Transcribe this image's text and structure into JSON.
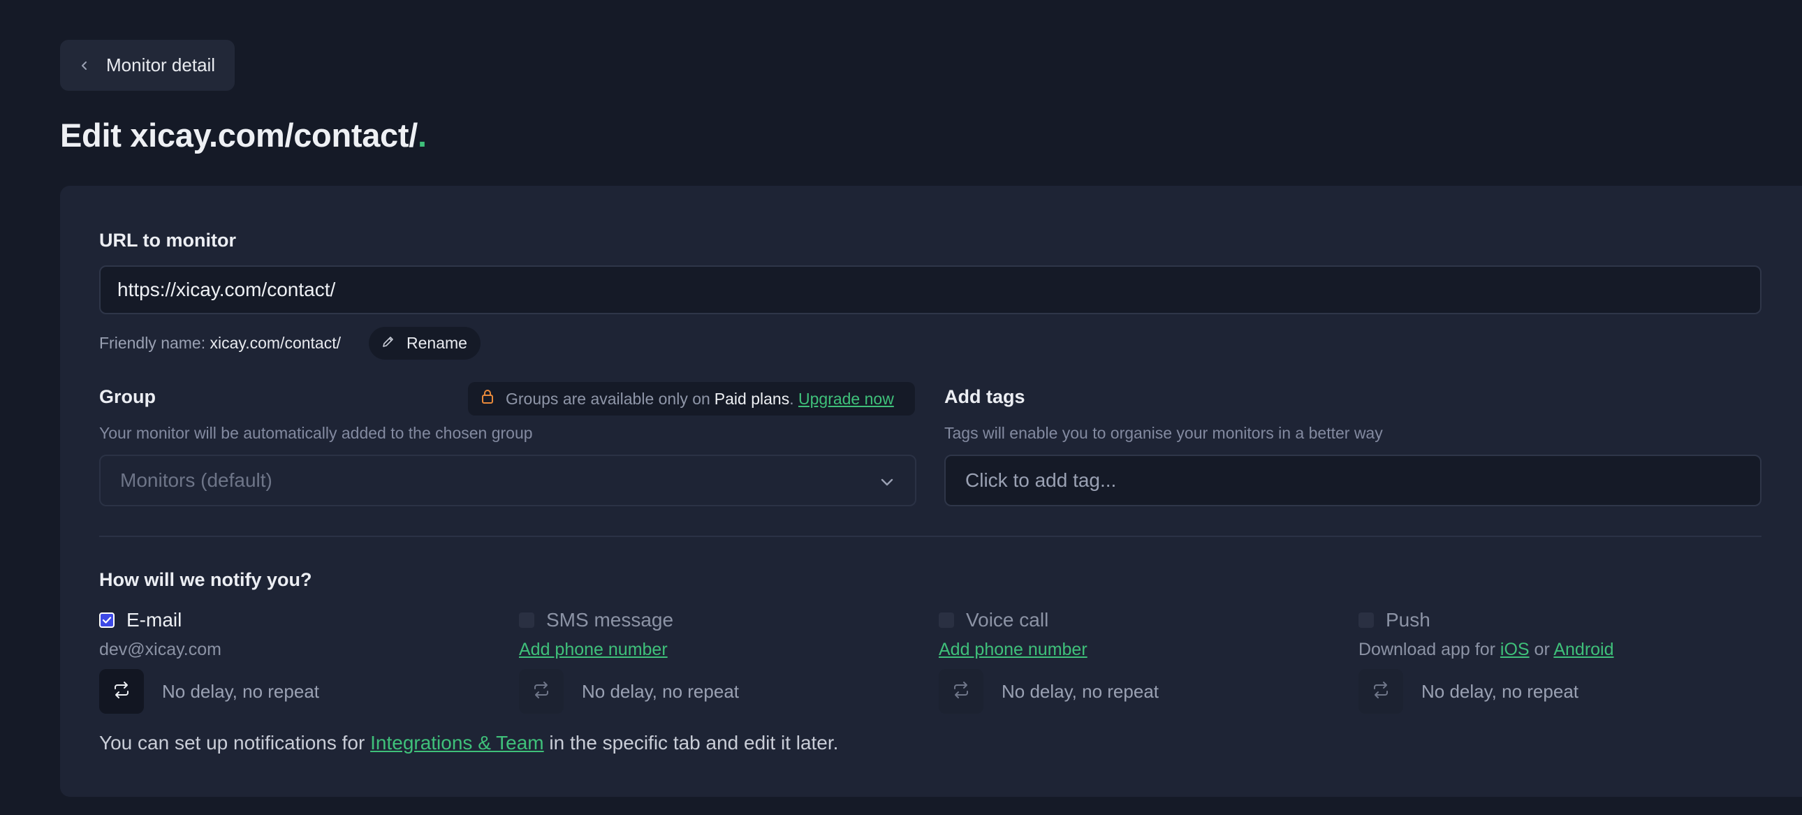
{
  "nav": {
    "back_label": "Monitor detail"
  },
  "page": {
    "title_prefix": "Edit ",
    "title_name": "xicay.com/contact/",
    "title_dot": "."
  },
  "url_section": {
    "label": "URL to monitor",
    "value": "https://xicay.com/contact/",
    "friendly_prefix": "Friendly name: ",
    "friendly_value": "xicay.com/contact/",
    "rename_label": "Rename"
  },
  "group": {
    "label": "Group",
    "hint": "Your monitor will be automatically added to the chosen group",
    "selected": "Monitors (default)",
    "notice_text": "Groups are available only on",
    "notice_plan": "Paid plans",
    "notice_punct": ".",
    "notice_link": "Upgrade now"
  },
  "tags": {
    "label": "Add tags",
    "hint": "Tags will enable you to organise your monitors in a better way",
    "placeholder": "Click to add tag..."
  },
  "notify": {
    "heading": "How will we notify you?",
    "channels": [
      {
        "label": "E-mail",
        "checked": true,
        "sub_text": "dev@xicay.com",
        "repeat_text": "No delay, no repeat"
      },
      {
        "label": "SMS message",
        "checked": false,
        "sub_link": "Add phone number",
        "repeat_text": "No delay, no repeat"
      },
      {
        "label": "Voice call",
        "checked": false,
        "sub_link": "Add phone number",
        "repeat_text": "No delay, no repeat"
      },
      {
        "label": "Push",
        "checked": false,
        "sub_prefix": "Download app for ",
        "sub_link_1": "iOS",
        "sub_mid": " or ",
        "sub_link_2": "Android",
        "repeat_text": "No delay, no repeat"
      }
    ],
    "footer_prefix": "You can set up notifications for ",
    "footer_link": "Integrations & Team",
    "footer_suffix": " in the specific tab and edit it later."
  },
  "colors": {
    "background": "#151a27",
    "card": "#1e2435",
    "accent_green": "#3fc07a",
    "checkbox_blue": "#3d49e6"
  }
}
